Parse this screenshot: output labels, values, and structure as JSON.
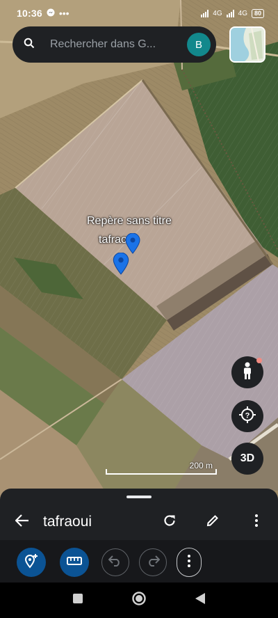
{
  "status_bar": {
    "time": "10:36",
    "network_left": "4G",
    "network_right": "4G",
    "battery": "80"
  },
  "search": {
    "placeholder": "Rechercher dans G...",
    "avatar_letter": "B"
  },
  "map": {
    "placemarks": [
      {
        "label": "Repère sans titre"
      },
      {
        "label": "tafraoui"
      }
    ],
    "scale_label": "200 m"
  },
  "buttons": {
    "three_d_label": "3D"
  },
  "sheet": {
    "title": "tafraoui"
  },
  "icons": {
    "search": "search-icon",
    "back": "arrow-left-icon",
    "refresh": "refresh-icon",
    "edit": "pencil-icon",
    "more": "more-vert-icon",
    "add_place": "add-location-icon",
    "measure": "ruler-icon",
    "undo": "undo-icon",
    "redo": "redo-icon"
  },
  "colors": {
    "accent": "#0b5394",
    "pin": "#1a73e8",
    "avatar": "#12888c",
    "panel": "#1f2124"
  }
}
